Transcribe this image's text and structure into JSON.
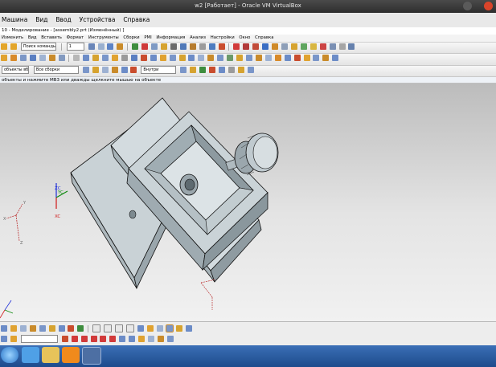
{
  "vbox": {
    "title": "w2 [Работает] - Oracle VM VirtualBox",
    "menu": [
      "Машина",
      "Вид",
      "Ввод",
      "Устройства",
      "Справка"
    ]
  },
  "nx": {
    "title": "10 - Моделирование - [assembly2.prt (Изменённый) ]",
    "menu": [
      "Изменить",
      "Вид",
      "Вставить",
      "Формат",
      "Инструменты",
      "Сборки",
      "PMI",
      "Информация",
      "Анализ",
      "Настройки",
      "Окно",
      "Справка"
    ],
    "search_placeholder": "Поиск команды",
    "count_value": "1",
    "filter_value": "Все сборки",
    "inside_value": "Внутри",
    "selection_label": "объекты вб",
    "cue_line": "объекты и нажмите МВ3 или дважды щелкните мышью на объекте"
  },
  "viewport": {
    "axis_yc": "YC",
    "axis_xc": "XC",
    "axis_zc": "ZC",
    "axis_x": "X",
    "axis_y": "Y",
    "axis_z": "Z"
  },
  "colors": {
    "part_face": "#c5ced3",
    "part_dark": "#97a3aa",
    "part_light": "#dde4e7",
    "edge": "#101010",
    "axis_red": "#d01818",
    "axis_green": "#108a10",
    "axis_blue": "#1e2ed8"
  },
  "icons": [
    "undo-icon",
    "redo-icon",
    "select-icon",
    "snap-icon",
    "view-icon",
    "render-icon",
    "feature-icon",
    "sketch-icon",
    "extrude-icon",
    "assembly-icon",
    "windows-start-icon",
    "ie-icon",
    "folder-icon",
    "media-icon",
    "nx-icon",
    "window-icon"
  ]
}
